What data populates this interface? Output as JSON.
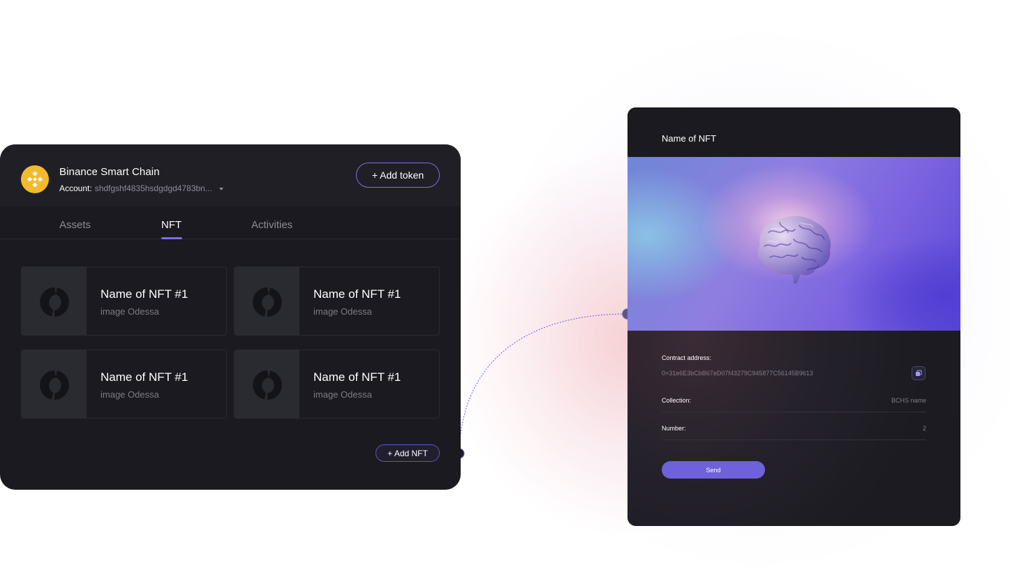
{
  "colors": {
    "accent": "#7b6fe0",
    "panel_bg": "#1b1a20",
    "header_bg": "#201f26",
    "muted_text": "#8d8b96",
    "binance_yellow": "#f3ba2f",
    "send_button": "#6d62da"
  },
  "wallet": {
    "chain_name": "Binance Smart Chain",
    "chain_icon": "binance-icon",
    "account_label": "Account:",
    "account_value": "shdfgshf4835hsdgdgd4783bn...",
    "add_token_label": "+ Add token",
    "tabs": [
      {
        "label": "Assets",
        "active": false
      },
      {
        "label": "NFT",
        "active": true
      },
      {
        "label": "Activities",
        "active": false
      }
    ],
    "nfts": [
      {
        "name": "Name of NFT #1",
        "subtitle": "image Odessa",
        "icon": "nft-placeholder-icon"
      },
      {
        "name": "Name of NFT #1",
        "subtitle": "image Odessa",
        "icon": "nft-placeholder-icon"
      },
      {
        "name": "Name of NFT #1",
        "subtitle": "image Odessa",
        "icon": "nft-placeholder-icon"
      },
      {
        "name": "Name of NFT #1",
        "subtitle": "image Odessa",
        "icon": "nft-placeholder-icon"
      }
    ],
    "add_nft_label": "+ Add NFT"
  },
  "detail": {
    "title": "Name of NFT",
    "image_subject": "brain",
    "contract_label": "Contract address:",
    "contract_value": "0×31e6E3bCbB67eD07f43279C945877C56145B9613",
    "copy_icon": "copy-icon",
    "collection_label": "Collection:",
    "collection_value": "BCHS name",
    "number_label": "Number:",
    "number_value": "2",
    "send_label": "Send"
  }
}
